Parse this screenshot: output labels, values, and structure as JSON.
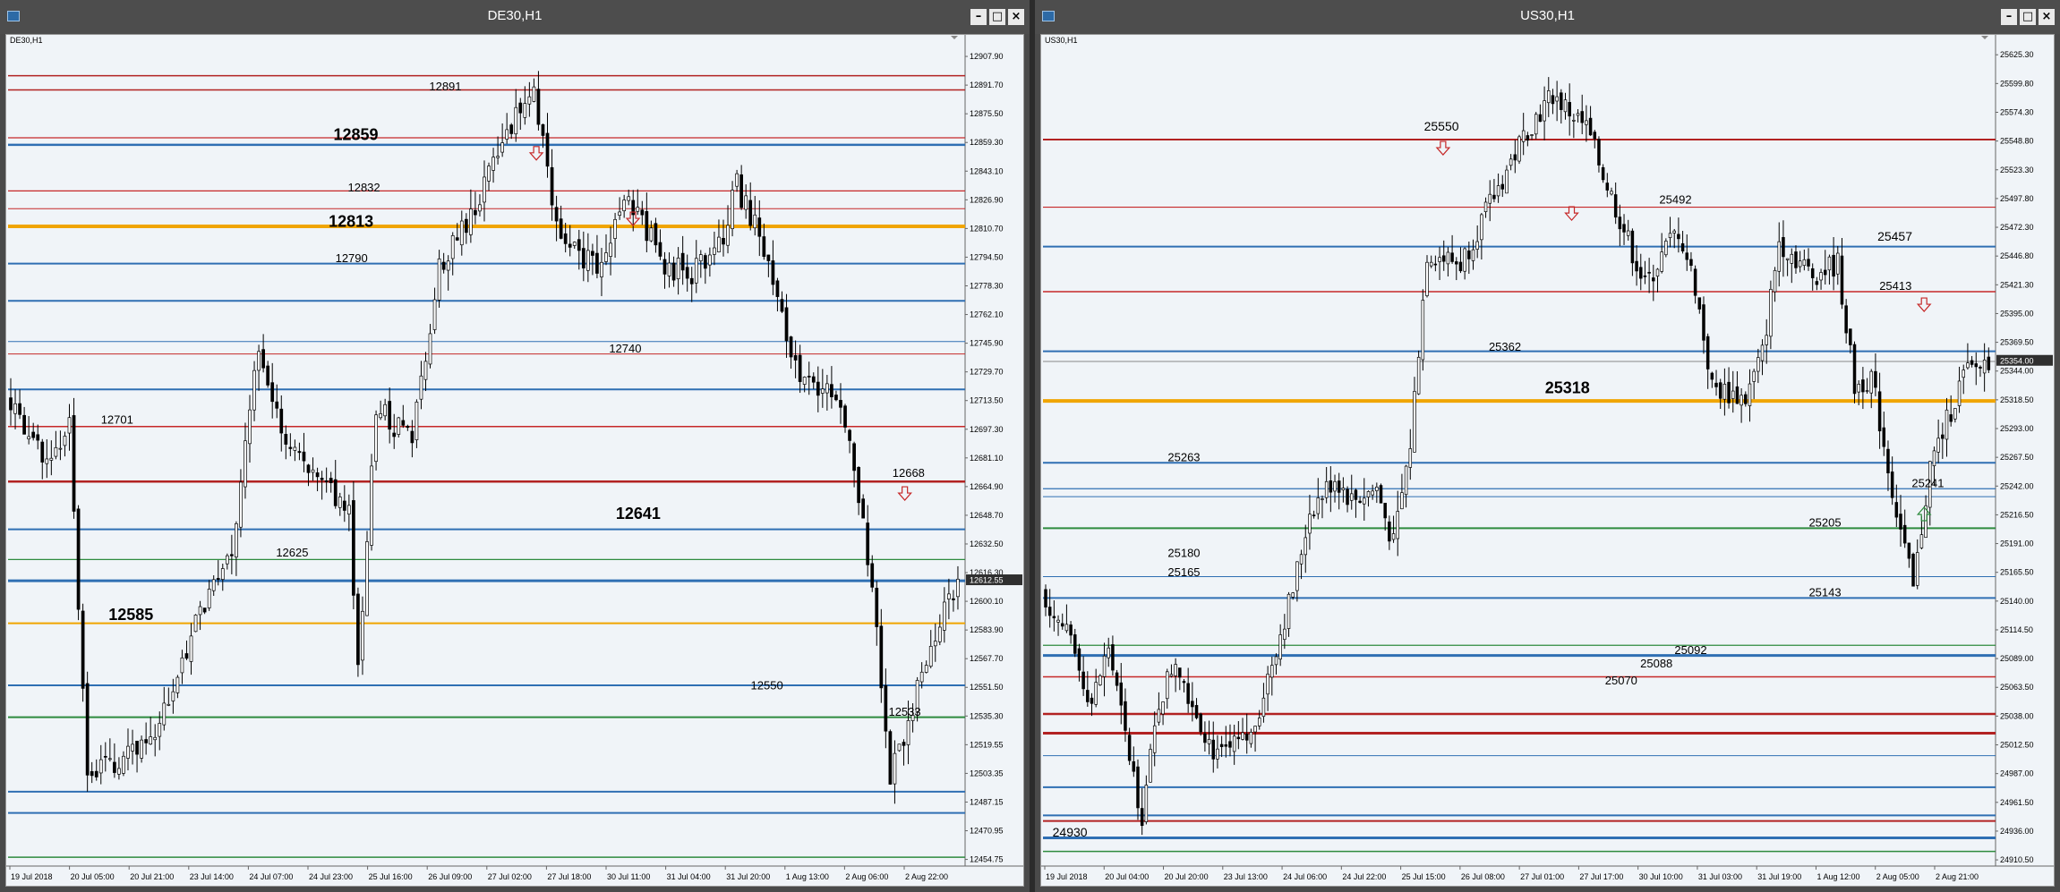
{
  "windows": [
    {
      "title": "DE30,H1",
      "symbol_label": "DE30,H1",
      "y_min": 12451,
      "y_max": 12915,
      "bars": 211,
      "seed": 1,
      "price_path": [
        [
          0,
          12715
        ],
        [
          8,
          12680
        ],
        [
          14,
          12700
        ],
        [
          18,
          12500
        ],
        [
          24,
          12510
        ],
        [
          34,
          12530
        ],
        [
          44,
          12600
        ],
        [
          50,
          12625
        ],
        [
          56,
          12745
        ],
        [
          62,
          12690
        ],
        [
          70,
          12670
        ],
        [
          76,
          12650
        ],
        [
          78,
          12560
        ],
        [
          82,
          12710
        ],
        [
          90,
          12690
        ],
        [
          96,
          12790
        ],
        [
          104,
          12822
        ],
        [
          112,
          12870
        ],
        [
          117,
          12890
        ],
        [
          120,
          12840
        ],
        [
          124,
          12800
        ],
        [
          132,
          12790
        ],
        [
          138,
          12830
        ],
        [
          146,
          12790
        ],
        [
          152,
          12785
        ],
        [
          158,
          12800
        ],
        [
          162,
          12835
        ],
        [
          168,
          12800
        ],
        [
          172,
          12760
        ],
        [
          176,
          12720
        ],
        [
          182,
          12725
        ],
        [
          186,
          12700
        ],
        [
          190,
          12650
        ],
        [
          193,
          12580
        ],
        [
          196,
          12500
        ],
        [
          202,
          12550
        ],
        [
          208,
          12600
        ],
        [
          211,
          12612
        ]
      ],
      "current_price": 12612.55,
      "h_lines": [
        {
          "price": 12897,
          "color": "#b22222",
          "width": 1.5
        },
        {
          "price": 12889,
          "color": "#b22222",
          "width": 1.5
        },
        {
          "price": 12862,
          "color": "#c62828",
          "width": 1.2
        },
        {
          "price": 12858,
          "color": "#2f6fb3",
          "width": 2.5
        },
        {
          "price": 12832,
          "color": "#c62828",
          "width": 1.2
        },
        {
          "price": 12822,
          "color": "#c62828",
          "width": 1
        },
        {
          "price": 12812,
          "color": "#f0a500",
          "width": 4
        },
        {
          "price": 12791,
          "color": "#2f6fb3",
          "width": 2
        },
        {
          "price": 12770,
          "color": "#2f6fb3",
          "width": 2
        },
        {
          "price": 12747,
          "color": "#2f6fb3",
          "width": 1
        },
        {
          "price": 12740,
          "color": "#c62828",
          "width": 1
        },
        {
          "price": 12720,
          "color": "#2f6fb3",
          "width": 2
        },
        {
          "price": 12699,
          "color": "#c62828",
          "width": 1.5
        },
        {
          "price": 12668,
          "color": "#b22222",
          "width": 2.5
        },
        {
          "price": 12641,
          "color": "#2f6fb3",
          "width": 2
        },
        {
          "price": 12624,
          "color": "#2e8b3e",
          "width": 1.2
        },
        {
          "price": 12612,
          "color": "#2f6fb3",
          "width": 3
        },
        {
          "price": 12588,
          "color": "#f0a500",
          "width": 2
        },
        {
          "price": 12553,
          "color": "#2f6fb3",
          "width": 2
        },
        {
          "price": 12535,
          "color": "#2e8b3e",
          "width": 2
        },
        {
          "price": 12493,
          "color": "#2f6fb3",
          "width": 2
        },
        {
          "price": 12481,
          "color": "#2f6fb3",
          "width": 2
        },
        {
          "price": 12456,
          "color": "#2e8b3e",
          "width": 1.5
        }
      ],
      "levels": [
        {
          "text": "12891",
          "size": 13,
          "xf": 0.44,
          "price": 12891
        },
        {
          "text": "12859",
          "size": 18,
          "xf": 0.34,
          "price": 12864
        },
        {
          "text": "12832",
          "size": 13,
          "xf": 0.355,
          "price": 12834
        },
        {
          "text": "12813",
          "size": 18,
          "xf": 0.335,
          "price": 12815
        },
        {
          "text": "12790",
          "size": 13,
          "xf": 0.342,
          "price": 12794
        },
        {
          "text": "12740",
          "size": 13,
          "xf": 0.628,
          "price": 12743
        },
        {
          "text": "12701",
          "size": 13,
          "xf": 0.097,
          "price": 12703
        },
        {
          "text": "12668",
          "size": 13,
          "xf": 0.924,
          "price": 12673
        },
        {
          "text": "12641",
          "size": 18,
          "xf": 0.635,
          "price": 12650
        },
        {
          "text": "12625",
          "size": 13,
          "xf": 0.28,
          "price": 12628
        },
        {
          "text": "12585",
          "size": 18,
          "xf": 0.105,
          "price": 12593
        },
        {
          "text": "12550",
          "size": 13,
          "xf": 0.776,
          "price": 12553
        },
        {
          "text": "12533",
          "size": 13,
          "xf": 0.92,
          "price": 12538
        }
      ],
      "arrows": [
        {
          "dir": "down",
          "color": "#c62828",
          "xf": 0.552,
          "price": 12853
        },
        {
          "dir": "down",
          "color": "#c62828",
          "xf": 0.653,
          "price": 12816
        },
        {
          "dir": "down",
          "color": "#c62828",
          "xf": 0.937,
          "price": 12661
        }
      ],
      "y_labels": [
        "12907.90",
        "12891.70",
        "12875.50",
        "12859.30",
        "12843.10",
        "12826.90",
        "12810.70",
        "12794.50",
        "12778.30",
        "12762.10",
        "12745.90",
        "12729.70",
        "12713.50",
        "12697.30",
        "12681.10",
        "12664.90",
        "12648.70",
        "12632.50",
        "12616.30",
        "12600.10",
        "12583.90",
        "12567.70",
        "12551.50",
        "12535.30",
        "12519.55",
        "12503.35",
        "12487.15",
        "12470.95",
        "12454.75"
      ],
      "x_labels": [
        "19 Jul 2018",
        "20 Jul 05:00",
        "20 Jul 21:00",
        "23 Jul 14:00",
        "24 Jul 07:00",
        "24 Jul 23:00",
        "25 Jul 16:00",
        "26 Jul 09:00",
        "27 Jul 02:00",
        "27 Jul 18:00",
        "30 Jul 11:00",
        "31 Jul 04:00",
        "31 Jul 20:00",
        "1 Aug 13:00",
        "2 Aug 06:00",
        "2 Aug 22:00"
      ]
    },
    {
      "title": "US30,H1",
      "symbol_label": "US30,H1",
      "y_min": 24905,
      "y_max": 25635,
      "bars": 211,
      "seed": 7,
      "price_path": [
        [
          0,
          25150
        ],
        [
          6,
          25110
        ],
        [
          12,
          25050
        ],
        [
          16,
          25100
        ],
        [
          20,
          25020
        ],
        [
          24,
          24950
        ],
        [
          28,
          25050
        ],
        [
          32,
          25090
        ],
        [
          36,
          25050
        ],
        [
          42,
          25000
        ],
        [
          50,
          25020
        ],
        [
          56,
          25100
        ],
        [
          60,
          25150
        ],
        [
          64,
          25220
        ],
        [
          70,
          25250
        ],
        [
          74,
          25230
        ],
        [
          80,
          25240
        ],
        [
          84,
          25190
        ],
        [
          88,
          25280
        ],
        [
          92,
          25450
        ],
        [
          100,
          25440
        ],
        [
          108,
          25500
        ],
        [
          116,
          25560
        ],
        [
          122,
          25590
        ],
        [
          130,
          25560
        ],
        [
          138,
          25480
        ],
        [
          144,
          25420
        ],
        [
          150,
          25460
        ],
        [
          152,
          25470
        ],
        [
          156,
          25420
        ],
        [
          160,
          25330
        ],
        [
          168,
          25320
        ],
        [
          172,
          25360
        ],
        [
          176,
          25460
        ],
        [
          184,
          25430
        ],
        [
          190,
          25440
        ],
        [
          194,
          25330
        ],
        [
          198,
          25340
        ],
        [
          204,
          25220
        ],
        [
          208,
          25150
        ],
        [
          212,
          25260
        ],
        [
          220,
          25340
        ],
        [
          226,
          25355
        ]
      ],
      "current_price": 25354.0,
      "h_lines": [
        {
          "price": 25550,
          "color": "#b22222",
          "width": 2
        },
        {
          "price": 25490,
          "color": "#c62828",
          "width": 1.2
        },
        {
          "price": 25455,
          "color": "#2f6fb3",
          "width": 2
        },
        {
          "price": 25415,
          "color": "#c62828",
          "width": 1.5
        },
        {
          "price": 25362,
          "color": "#2f6fb3",
          "width": 2
        },
        {
          "price": 25353,
          "color": "#888888",
          "width": 1
        },
        {
          "price": 25318,
          "color": "#f0a500",
          "width": 4
        },
        {
          "price": 25263,
          "color": "#2f6fb3",
          "width": 2
        },
        {
          "price": 25240,
          "color": "#2f6fb3",
          "width": 1.2
        },
        {
          "price": 25233,
          "color": "#2f6fb3",
          "width": 1
        },
        {
          "price": 25205,
          "color": "#2e8b3e",
          "width": 2
        },
        {
          "price": 25162,
          "color": "#2f6fb3",
          "width": 1
        },
        {
          "price": 25143,
          "color": "#2f6fb3",
          "width": 2
        },
        {
          "price": 25101,
          "color": "#2e8b3e",
          "width": 1.2
        },
        {
          "price": 25092,
          "color": "#2f6fb3",
          "width": 3
        },
        {
          "price": 25073,
          "color": "#c62828",
          "width": 1.5
        },
        {
          "price": 25040,
          "color": "#b22222",
          "width": 2.5
        },
        {
          "price": 25023,
          "color": "#b22222",
          "width": 3
        },
        {
          "price": 25003,
          "color": "#2f6fb3",
          "width": 1
        },
        {
          "price": 24975,
          "color": "#2f6fb3",
          "width": 2
        },
        {
          "price": 24950,
          "color": "#2f6fb3",
          "width": 2
        },
        {
          "price": 24945,
          "color": "#b22222",
          "width": 2
        },
        {
          "price": 24930,
          "color": "#2f6fb3",
          "width": 3
        },
        {
          "price": 24918,
          "color": "#2e8b3e",
          "width": 1.5
        }
      ],
      "levels": [
        {
          "text": "25550",
          "size": 14,
          "xf": 0.4,
          "price": 25562
        },
        {
          "text": "25492",
          "size": 13,
          "xf": 0.647,
          "price": 25497
        },
        {
          "text": "25457",
          "size": 14,
          "xf": 0.876,
          "price": 25464
        },
        {
          "text": "25413",
          "size": 13,
          "xf": 0.878,
          "price": 25420
        },
        {
          "text": "25362",
          "size": 13,
          "xf": 0.468,
          "price": 25366
        },
        {
          "text": "25318",
          "size": 18,
          "xf": 0.527,
          "price": 25330
        },
        {
          "text": "25263",
          "size": 13,
          "xf": 0.131,
          "price": 25268
        },
        {
          "text": "25241",
          "size": 13,
          "xf": 0.912,
          "price": 25245
        },
        {
          "text": "25205",
          "size": 13,
          "xf": 0.804,
          "price": 25210
        },
        {
          "text": "25180",
          "size": 13,
          "xf": 0.131,
          "price": 25183
        },
        {
          "text": "25165",
          "size": 13,
          "xf": 0.131,
          "price": 25166
        },
        {
          "text": "25143",
          "size": 13,
          "xf": 0.804,
          "price": 25148
        },
        {
          "text": "25092",
          "size": 13,
          "xf": 0.663,
          "price": 25097
        },
        {
          "text": "25088",
          "size": 13,
          "xf": 0.627,
          "price": 25085
        },
        {
          "text": "25070",
          "size": 13,
          "xf": 0.59,
          "price": 25070
        },
        {
          "text": "24930",
          "size": 14,
          "xf": 0.01,
          "price": 24935
        }
      ],
      "arrows": [
        {
          "dir": "down",
          "color": "#c62828",
          "xf": 0.42,
          "price": 25542
        },
        {
          "dir": "down",
          "color": "#c62828",
          "xf": 0.555,
          "price": 25484
        },
        {
          "dir": "down",
          "color": "#c62828",
          "xf": 0.925,
          "price": 25403
        },
        {
          "dir": "up",
          "color": "#2e8b3e",
          "xf": 0.925,
          "price": 25218
        }
      ],
      "y_labels": [
        "25625.30",
        "25599.80",
        "25574.30",
        "25548.80",
        "25523.30",
        "25497.80",
        "25472.30",
        "25446.80",
        "25421.30",
        "25395.00",
        "25369.50",
        "25344.00",
        "25318.50",
        "25293.00",
        "25267.50",
        "25242.00",
        "25216.50",
        "25191.00",
        "25165.50",
        "25140.00",
        "25114.50",
        "25089.00",
        "25063.50",
        "25038.00",
        "25012.50",
        "24987.00",
        "24961.50",
        "24936.00",
        "24910.50"
      ],
      "x_labels": [
        "19 Jul 2018",
        "20 Jul 04:00",
        "20 Jul 20:00",
        "23 Jul 13:00",
        "24 Jul 06:00",
        "24 Jul 22:00",
        "25 Jul 15:00",
        "26 Jul 08:00",
        "27 Jul 01:00",
        "27 Jul 17:00",
        "30 Jul 10:00",
        "31 Jul 03:00",
        "31 Jul 19:00",
        "1 Aug 12:00",
        "2 Aug 05:00",
        "2 Aug 21:00"
      ]
    }
  ]
}
